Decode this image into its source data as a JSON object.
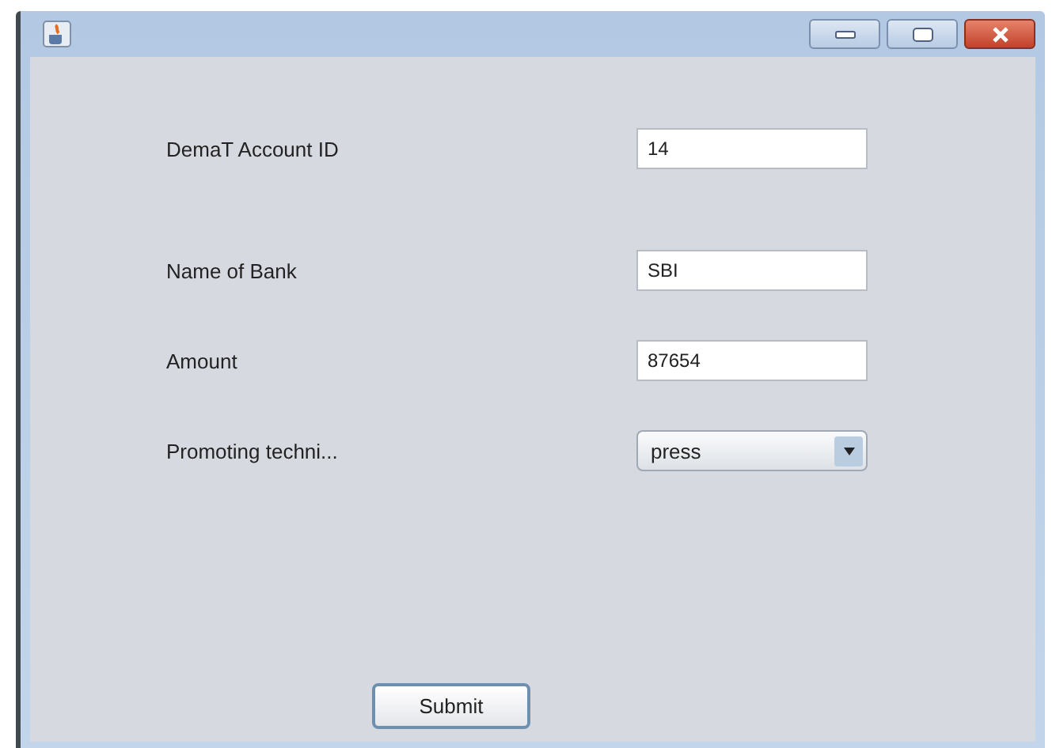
{
  "fields": [
    {
      "label": "DemaT Account ID",
      "kind": "text",
      "value": "14"
    },
    {
      "label": "Name of Bank",
      "kind": "text",
      "value": "SBI"
    },
    {
      "label": "Amount",
      "kind": "text",
      "value": "87654"
    },
    {
      "label": "Promoting techni...",
      "kind": "dropdown",
      "value": "press"
    }
  ],
  "buttons": [
    "Submit"
  ]
}
